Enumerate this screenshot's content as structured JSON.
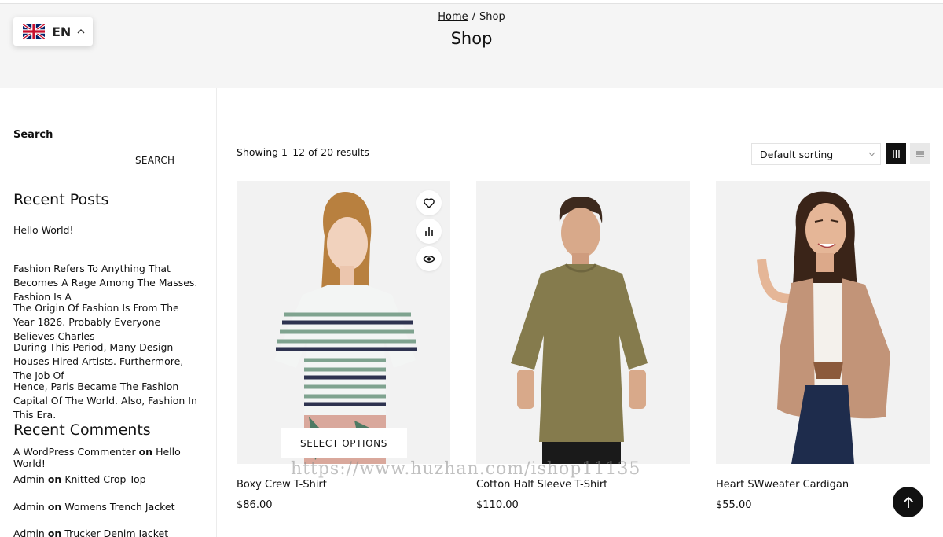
{
  "language": {
    "code": "EN"
  },
  "breadcrumb": {
    "home": "Home",
    "separator": "/",
    "current": "Shop"
  },
  "page_title": "Shop",
  "sidebar": {
    "search_title": "Search",
    "search_button": "SEARCH",
    "recent_posts_title": "Recent Posts",
    "recent_posts": [
      "Hello World!",
      "Fashion Refers To Anything That Becomes A Rage Among The Masses. Fashion Is A",
      "The Origin Of Fashion Is From The Year 1826. Probably Everyone Believes Charles",
      "During This Period, Many Design Houses Hired Artists. Furthermore, The Job Of",
      "Hence, Paris Became The Fashion Capital Of The World. Also, Fashion In This Era."
    ],
    "recent_comments_title": "Recent Comments",
    "recent_comments": [
      {
        "author": "A WordPress Commenter",
        "on": "on",
        "post": "Hello World!"
      },
      {
        "author": "Admin",
        "on": "on",
        "post": "Knitted Crop Top"
      },
      {
        "author": "Admin",
        "on": "on",
        "post": "Womens Trench Jacket"
      },
      {
        "author": "Admin",
        "on": "on",
        "post": "Trucker Denim Jacket"
      }
    ]
  },
  "toolbar": {
    "result_count": "Showing 1–12 of 20 results",
    "sort_selected": "Default sorting",
    "grid_view_icon": "grid-view-icon",
    "list_view_icon": "list-view-icon"
  },
  "products": [
    {
      "name": "Boxy Crew T-Shirt",
      "price": "$86.00",
      "action_label": "SELECT OPTIONS"
    },
    {
      "name": "Cotton Half Sleeve T-Shirt",
      "price": "$110.00"
    },
    {
      "name": "Heart SWweater Cardigan",
      "price": "$55.00"
    }
  ],
  "watermark": "https://www.huzhan.com/ishop11135",
  "colors": {
    "accent": "#111111",
    "header_bg": "#f5f5f5",
    "image_bg": "#f2f2f2"
  }
}
